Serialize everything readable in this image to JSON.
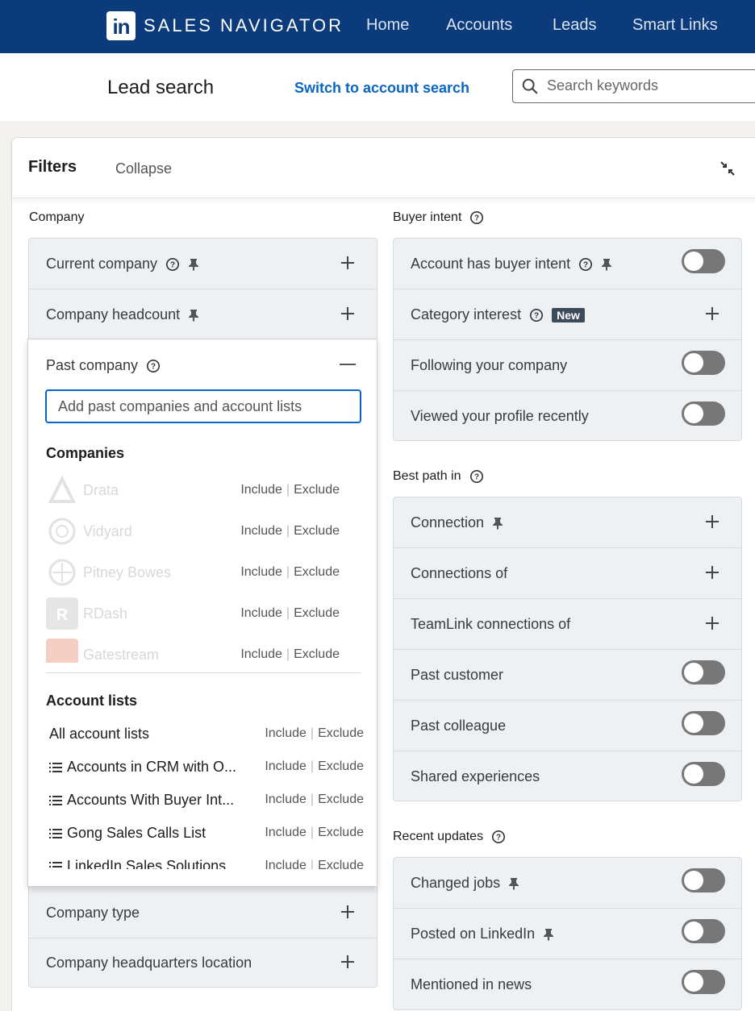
{
  "nav": {
    "logo": "in",
    "brand": "SALES NAVIGATOR",
    "links": [
      "Home",
      "Accounts",
      "Leads",
      "Smart Links"
    ]
  },
  "search_row": {
    "title": "Lead search",
    "switch_link": "Switch to account search",
    "search_placeholder": "Search keywords"
  },
  "filters": {
    "title": "Filters",
    "collapse": "Collapse"
  },
  "company": {
    "title": "Company",
    "rows": {
      "current_company": "Current company",
      "company_headcount": "Company headcount",
      "past_company": "Past company",
      "company_type": "Company type",
      "company_hq": "Company headquarters location"
    },
    "past_company_panel": {
      "input_placeholder": "Add past companies and account lists",
      "companies_title": "Companies",
      "companies": [
        "Drata",
        "Vidyard",
        "Pitney Bowes",
        "RDash",
        "Gatestream"
      ],
      "account_lists_title": "Account lists",
      "account_lists": [
        "All account lists",
        "Accounts in CRM with O...",
        "Accounts With Buyer Int...",
        "Gong Sales Calls List",
        "LinkedIn Sales Solutions"
      ],
      "include": "Include",
      "exclude": "Exclude"
    }
  },
  "buyer_intent": {
    "title": "Buyer intent",
    "rows": {
      "account_intent": "Account has buyer intent",
      "category_interest": "Category interest",
      "new_badge": "New",
      "following": "Following your company",
      "viewed_profile": "Viewed your profile recently"
    }
  },
  "best_path": {
    "title": "Best path in",
    "rows": {
      "connection": "Connection",
      "connections_of": "Connections of",
      "teamlink": "TeamLink connections of",
      "past_customer": "Past customer",
      "past_colleague": "Past colleague",
      "shared_experiences": "Shared experiences"
    }
  },
  "recent_updates": {
    "title": "Recent updates",
    "rows": {
      "changed_jobs": "Changed jobs",
      "posted": "Posted on LinkedIn",
      "mentioned": "Mentioned in news"
    }
  },
  "colors": {
    "nav_bg": "#0b3b7a",
    "accent": "#0a66c2",
    "row_bg": "#eef1f4",
    "toggle_off": "#777777"
  },
  "icons": [
    "search-icon",
    "help-icon",
    "pin-icon",
    "plus-icon",
    "minus-icon",
    "shrink-icon",
    "list-icon"
  ]
}
